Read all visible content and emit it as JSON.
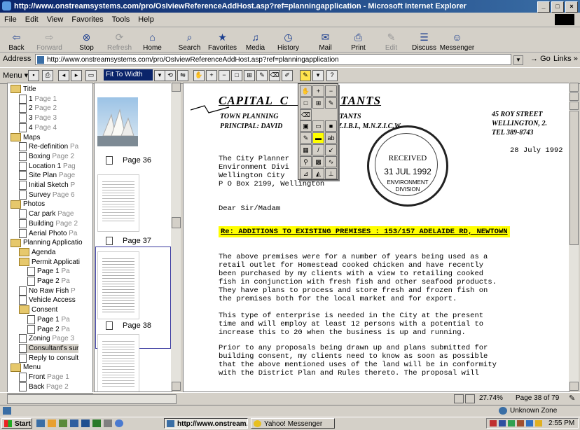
{
  "window": {
    "title": "http://www.onstreamsystems.com/pro/OsIviewReferenceAddHost.asp?ref=planningapplication - Microsoft Internet Explorer",
    "buttons": [
      "_",
      "□",
      "×"
    ]
  },
  "menu": [
    "File",
    "Edit",
    "View",
    "Favorites",
    "Tools",
    "Help"
  ],
  "toolbar": [
    {
      "label": "Back",
      "icon": "back-arrow-icon",
      "enabled": true
    },
    {
      "label": "Forward",
      "icon": "forward-arrow-icon",
      "enabled": false
    },
    {
      "label": "Stop",
      "icon": "stop-icon",
      "enabled": true
    },
    {
      "label": "Refresh",
      "icon": "refresh-icon",
      "enabled": false
    },
    {
      "label": "Home",
      "icon": "home-icon",
      "enabled": true
    },
    {
      "label": "Search",
      "icon": "search-icon",
      "enabled": true
    },
    {
      "label": "Favorites",
      "icon": "favorites-icon",
      "enabled": true
    },
    {
      "label": "Media",
      "icon": "media-icon",
      "enabled": true
    },
    {
      "label": "History",
      "icon": "history-icon",
      "enabled": true
    },
    {
      "label": "Mail",
      "icon": "mail-icon",
      "enabled": true
    },
    {
      "label": "Print",
      "icon": "print-icon",
      "enabled": true
    },
    {
      "label": "Edit",
      "icon": "edit-icon",
      "enabled": false
    },
    {
      "label": "Discuss",
      "icon": "discuss-icon",
      "enabled": true
    },
    {
      "label": "Messenger",
      "icon": "messenger-icon",
      "enabled": true
    }
  ],
  "address": {
    "label": "Address",
    "url": "http://www.onstreamsystems.com/pro/OsIviewReferenceAddHost.asp?ref=planningapplication",
    "go": "Go",
    "links": "Links"
  },
  "viewer": {
    "menu_label": "Menu",
    "zoom_select": "Fit To Width"
  },
  "tree": [
    {
      "label": "Title",
      "page": "",
      "level": 0,
      "type": "folder"
    },
    {
      "label": "1",
      "page": "Page 1",
      "level": 1,
      "type": "doc"
    },
    {
      "label": "2",
      "page": "Page 2",
      "level": 1,
      "type": "doc"
    },
    {
      "label": "3",
      "page": "Page 3",
      "level": 1,
      "type": "doc"
    },
    {
      "label": "4",
      "page": "Page 4",
      "level": 1,
      "type": "doc"
    },
    {
      "label": "Maps",
      "page": "",
      "level": 0,
      "type": "folder"
    },
    {
      "label": "Re-definition",
      "page": "Pa",
      "level": 1,
      "type": "doc"
    },
    {
      "label": "Boxing",
      "page": "Page 2",
      "level": 1,
      "type": "doc"
    },
    {
      "label": "Location 1",
      "page": "Pag",
      "level": 1,
      "type": "doc"
    },
    {
      "label": "Site Plan",
      "page": "Page",
      "level": 1,
      "type": "doc"
    },
    {
      "label": "Initial Sketch",
      "page": "P",
      "level": 1,
      "type": "doc"
    },
    {
      "label": "Survey",
      "page": "Page 6",
      "level": 1,
      "type": "doc"
    },
    {
      "label": "Photos",
      "page": "",
      "level": 0,
      "type": "folder"
    },
    {
      "label": "Car park",
      "page": "Page",
      "level": 1,
      "type": "doc"
    },
    {
      "label": "Building",
      "page": "Page 2",
      "level": 1,
      "type": "doc"
    },
    {
      "label": "Aerial Photo",
      "page": "Pa",
      "level": 1,
      "type": "doc"
    },
    {
      "label": "Planning Applicatio",
      "page": "",
      "level": 0,
      "type": "folder"
    },
    {
      "label": "Agenda",
      "page": "",
      "level": 1,
      "type": "folder"
    },
    {
      "label": "Permit Applicati",
      "page": "",
      "level": 1,
      "type": "folder"
    },
    {
      "label": "Page 1",
      "page": "Pa",
      "level": 2,
      "type": "doc"
    },
    {
      "label": "Page 2",
      "page": "Pa",
      "level": 2,
      "type": "doc"
    },
    {
      "label": "No Raw Fish",
      "page": "P",
      "level": 1,
      "type": "doc"
    },
    {
      "label": "Vehicle Access",
      "page": "",
      "level": 1,
      "type": "doc"
    },
    {
      "label": "Consent",
      "page": "",
      "level": 1,
      "type": "folder"
    },
    {
      "label": "Page 1",
      "page": "Pa",
      "level": 2,
      "type": "doc"
    },
    {
      "label": "Page 2",
      "page": "Pa",
      "level": 2,
      "type": "doc"
    },
    {
      "label": "Zoning",
      "page": "Page 3",
      "level": 1,
      "type": "doc"
    },
    {
      "label": "Consultant's sur",
      "page": "",
      "level": 1,
      "type": "doc",
      "selected": true
    },
    {
      "label": "Reply to consult",
      "page": "",
      "level": 1,
      "type": "doc"
    },
    {
      "label": "Menu",
      "page": "",
      "level": 0,
      "type": "folder"
    },
    {
      "label": "Front",
      "page": "Page 1",
      "level": 1,
      "type": "doc"
    },
    {
      "label": "Back",
      "page": "Page 2",
      "level": 1,
      "type": "doc"
    }
  ],
  "thumbnails": [
    {
      "label": "Page 36"
    },
    {
      "label": "Page 37"
    },
    {
      "label": "Page 38",
      "selected": true
    }
  ],
  "document": {
    "company": "CAPITAL  C            LTANTS",
    "sub1": "TOWN PLANNING               G CONSULTANTS",
    "sub2": "PRINCIPAL: DAVID            ER, R.M.N.Z.I.B.I., M.N.Z.I.C.W.",
    "addr1": "45 ROY STREET",
    "addr2": "WELLINGTON, 2.",
    "addr3": "TEL 389-8743",
    "date": "28 July 1992",
    "to1": "The City Planner",
    "to2": "Environment Divi",
    "to3": "Wellington City",
    "to4": "P O Box 2199, Wellington",
    "stamp_received": "RECEIVED",
    "stamp_date": "31 JUL 1992",
    "stamp_div1": "ENVIRONMENT",
    "stamp_div2": "DIVISION",
    "salutation": "Dear Sir/Madam",
    "subject": "Re: ADDITIONS TO EXISTING PREMISES : 153/157 ADELAIDE RD, NEWTOWN",
    "p1": [
      "The above premises were for a number of years being used as a",
      "retail outlet for Homestead cooked chicken and have recently",
      "been purchased by my clients with a view to retailing cooked",
      "fish in conjunction with fresh fish and other seafood products.",
      "They have plans to process and store fresh and frozen fish on",
      "the premises both for the local market and for export."
    ],
    "p2": [
      "This type of enterprise is needed in the City at the present",
      "time and will employ at least 12 persons with a potential to",
      "increase this to 20 when the business is up and running."
    ],
    "p3": [
      "Prior to any proposals being drawn up and plans submitted for",
      "building consent, my clients need to know as soon as possible",
      "that the above mentioned uses of the land will be in conformity",
      "with the District Plan and Rules thereto. The proposal will"
    ]
  },
  "viewer_status": {
    "zoom": "27.74%",
    "page": "Page 38 of 79"
  },
  "ie_status": {
    "zone": "Unknown Zone"
  },
  "taskbar": {
    "start": "Start",
    "tasks": [
      "http://www.onstream...",
      "Yahoo! Messenger"
    ],
    "clock": "2:55 PM"
  },
  "colors": {
    "highlight": "#ffff00",
    "title_bar": "#0a246a"
  }
}
